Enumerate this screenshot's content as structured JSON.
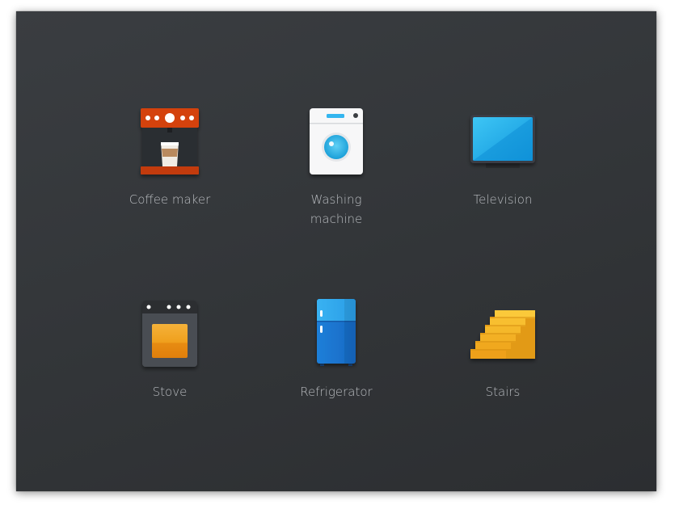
{
  "items": [
    {
      "label_line1": "Coffee maker",
      "label_line2": "",
      "icon": "coffee-maker-icon"
    },
    {
      "label_line1": "Washing",
      "label_line2": "machine",
      "icon": "washing-machine-icon"
    },
    {
      "label_line1": "Television",
      "label_line2": "",
      "icon": "television-icon"
    },
    {
      "label_line1": "Stove",
      "label_line2": "",
      "icon": "stove-icon"
    },
    {
      "label_line1": "Refrigerator",
      "label_line2": "",
      "icon": "refrigerator-icon"
    },
    {
      "label_line1": "Stairs",
      "label_line2": "",
      "icon": "stairs-icon"
    }
  ],
  "colors": {
    "background": "#36393d",
    "label": "#b9bcc0",
    "coffee_red": "#d4420f",
    "tv_blue": "#1ba7ea",
    "fridge_blue": "#2a8fe0",
    "stove_orange": "#f0a020",
    "stairs_gold": "#f2b11c"
  }
}
